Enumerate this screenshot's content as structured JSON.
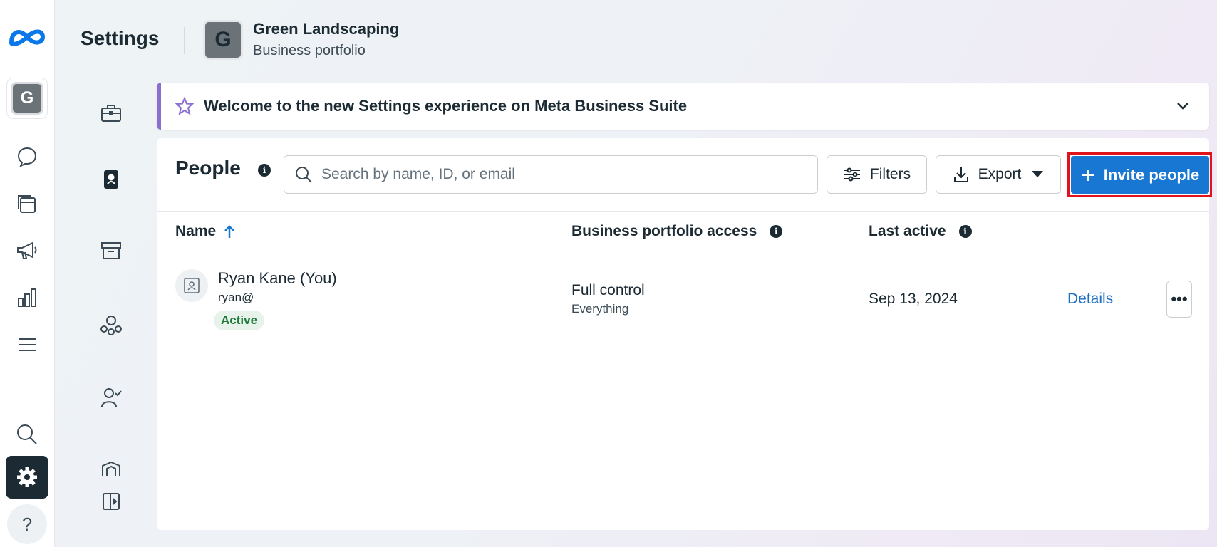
{
  "header": {
    "title": "Settings",
    "business_initial": "G",
    "business_name": "Green Landscaping",
    "business_subtitle": "Business portfolio"
  },
  "rail": {
    "account_initial": "G",
    "help_label": "?",
    "items": [
      "meta-logo",
      "account-avatar",
      "chat-icon",
      "pages-icon",
      "megaphone-icon",
      "bar-chart-icon",
      "menu-icon",
      "search-icon",
      "gear-icon",
      "help-icon"
    ]
  },
  "banner": {
    "text": "Welcome to the new Settings experience on Meta Business Suite"
  },
  "people": {
    "title": "People",
    "search_placeholder": "Search by name, ID, or email",
    "filters_label": "Filters",
    "export_label": "Export",
    "invite_label": "Invite people",
    "columns": {
      "name": "Name",
      "access": "Business portfolio access",
      "last_active": "Last active"
    },
    "rows": [
      {
        "name": "Ryan Kane (You)",
        "email": "ryan@",
        "status": "Active",
        "access": "Full control",
        "access_detail": "Everything",
        "last_active": "Sep 13, 2024",
        "action": "Details",
        "more": "•••"
      }
    ]
  },
  "colors": {
    "primary": "#1877d2",
    "highlight": "#e0131b",
    "banner_accent": "#8a6fd1",
    "active_badge_bg": "#e7f3ea",
    "active_badge_text": "#1f7a3a"
  }
}
